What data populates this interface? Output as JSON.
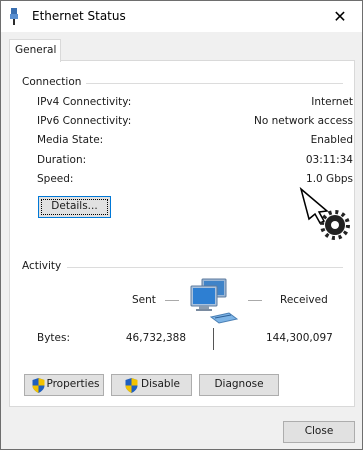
{
  "window": {
    "title": "Ethernet Status",
    "close_glyph": "✕"
  },
  "tab": {
    "label": "General"
  },
  "connection": {
    "heading": "Connection",
    "rows": [
      {
        "label": "IPv4 Connectivity:",
        "value": "Internet"
      },
      {
        "label": "IPv6 Connectivity:",
        "value": "No network access"
      },
      {
        "label": "Media State:",
        "value": "Enabled"
      },
      {
        "label": "Duration:",
        "value": "03:11:34"
      },
      {
        "label": "Speed:",
        "value": "1.0 Gbps"
      }
    ],
    "details_button": "Details..."
  },
  "activity": {
    "heading": "Activity",
    "sent_label": "Sent",
    "received_label": "Received",
    "bytes_label": "Bytes:",
    "bytes_sent": "46,732,388",
    "bytes_received": "144,300,097"
  },
  "buttons": {
    "properties": "Properties",
    "disable": "Disable",
    "diagnose": "Diagnose",
    "close": "Close"
  },
  "colors": {
    "accent": "#0078d7",
    "shield_blue": "#1f5fbf",
    "shield_yellow": "#f2c200"
  }
}
